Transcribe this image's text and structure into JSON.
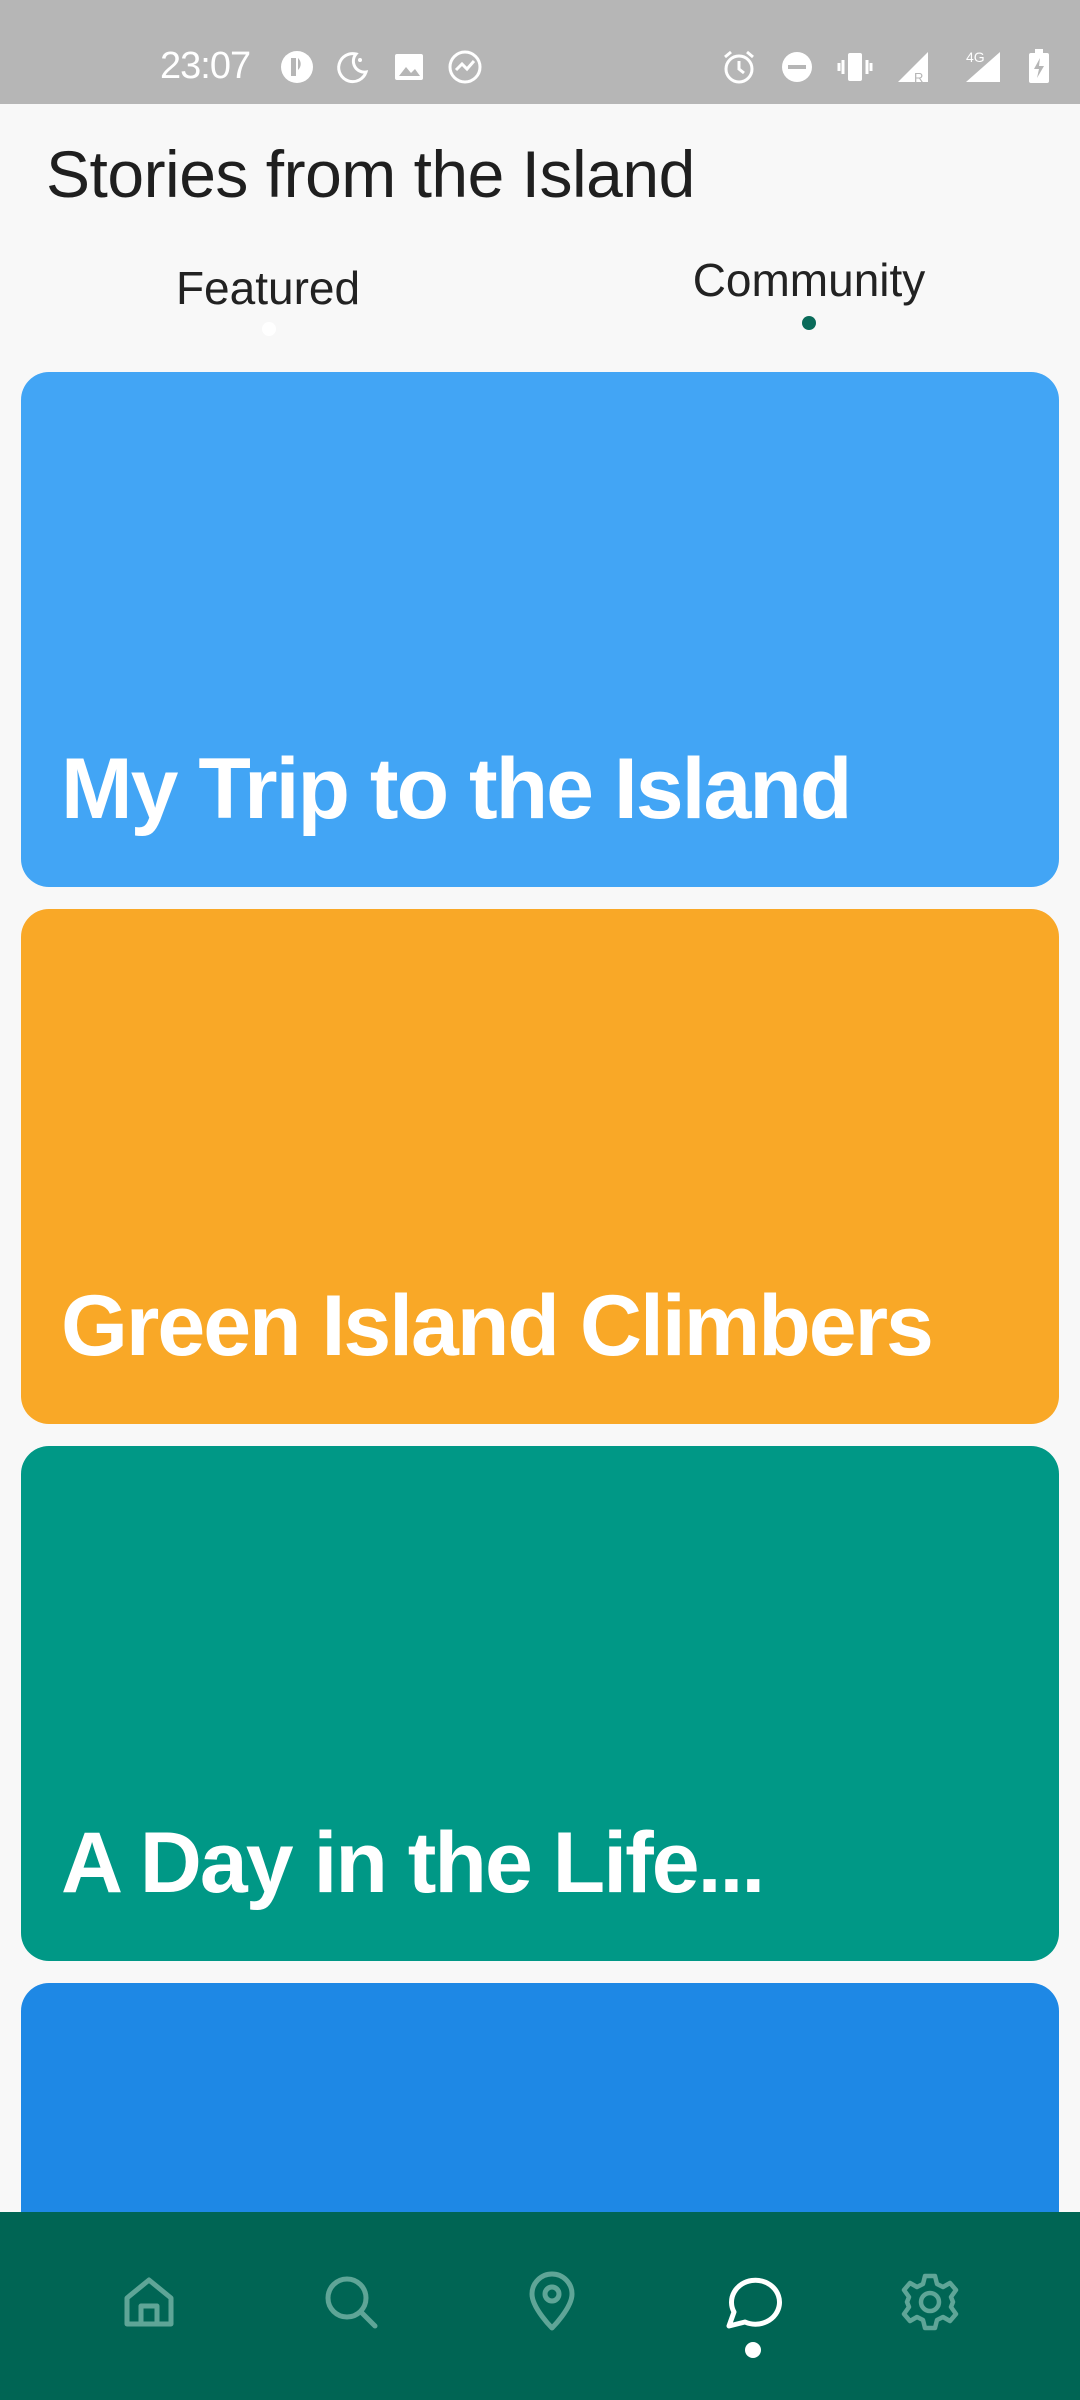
{
  "status_bar": {
    "time": "23:07",
    "left_icons": [
      "app-notification-icon",
      "moon-icon",
      "image-icon",
      "sync-icon"
    ],
    "right_icons": [
      "alarm-icon",
      "do-not-disturb-icon",
      "vibrate-icon",
      "signal-roaming-icon",
      "signal-4g-icon",
      "battery-charging-icon"
    ],
    "network_label": "4G",
    "roaming_label": "R"
  },
  "header": {
    "title": "Stories from the Island"
  },
  "tabs": [
    {
      "label": "Featured",
      "active": false
    },
    {
      "label": "Community",
      "active": true
    }
  ],
  "cards": [
    {
      "title": "My Trip to the Island",
      "color": "#42a5f5"
    },
    {
      "title": "Green Island Climbers",
      "color": "#f9a827"
    },
    {
      "title": "A Day in the Life...",
      "color": "#009886"
    },
    {
      "title": "",
      "color": "#1e88e5"
    }
  ],
  "bottom_nav": {
    "items": [
      {
        "icon": "home-icon",
        "active": false
      },
      {
        "icon": "search-icon",
        "active": false
      },
      {
        "icon": "location-pin-icon",
        "active": false
      },
      {
        "icon": "chat-bubble-icon",
        "active": true
      },
      {
        "icon": "gear-icon",
        "active": false
      }
    ],
    "background": "#006554",
    "inactive_color": "#5fa597",
    "active_color": "#ffffff"
  },
  "colors": {
    "accent": "#0a6b5a",
    "background": "#f8f8f8",
    "status_bar": "#b6b6b6"
  }
}
